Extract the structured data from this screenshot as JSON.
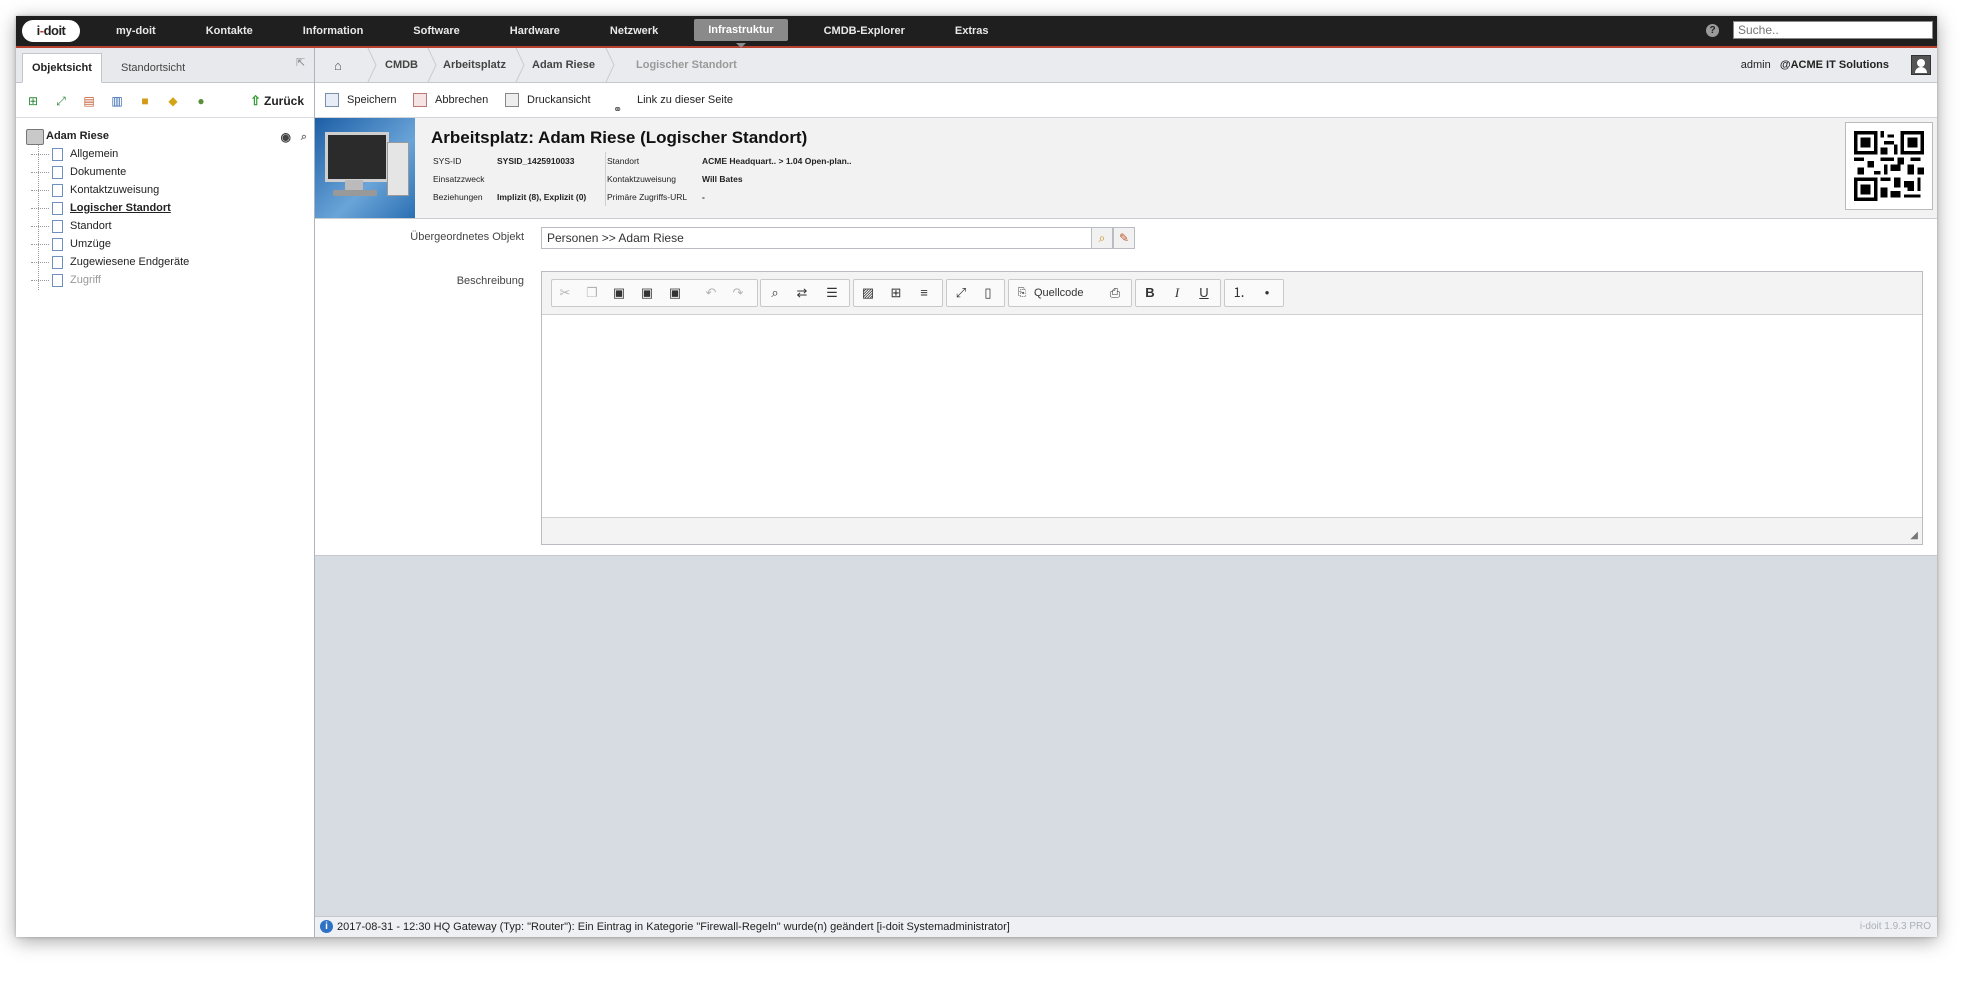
{
  "topnav": {
    "logo": "i-doit",
    "items": [
      "my-doit",
      "Kontakte",
      "Information",
      "Software",
      "Hardware",
      "Netzwerk",
      "Infrastruktur",
      "CMDB-Explorer",
      "Extras"
    ],
    "active_item": "Infrastruktur",
    "search_placeholder": "Suche.."
  },
  "left_panel": {
    "tabs": [
      "Objektsicht",
      "Standortsicht"
    ],
    "back_label": "Zurück",
    "tree": {
      "root": "Adam Riese",
      "items": [
        "Allgemein",
        "Dokumente",
        "Kontaktzuweisung",
        "Logischer Standort",
        "Standort",
        "Umzüge",
        "Zugewiesene Endgeräte",
        "Zugriff"
      ],
      "active": "Logischer Standort",
      "disabled": "Zugriff"
    }
  },
  "breadcrumb": [
    "CMDB",
    "Arbeitsplatz",
    "Adam Riese",
    "Logischer Standort"
  ],
  "user": {
    "name": "admin",
    "tenant": "@ACME IT Solutions"
  },
  "actions": [
    "Speichern",
    "Abbrechen",
    "Druckansicht",
    "Link zu dieser Seite"
  ],
  "object_header": {
    "title": "Arbeitsplatz: Adam Riese (Logischer Standort)",
    "left_labels": [
      "SYS-ID",
      "Einsatzzweck",
      "Beziehungen"
    ],
    "left_values": [
      "SYSID_1425910033",
      "",
      "Implizit (8), Explizit (0)"
    ],
    "right_labels": [
      "Standort",
      "Kontaktzuweisung",
      "Primäre Zugriffs-URL"
    ],
    "right_values": [
      "ACME Headquart.. > 1.04 Open-plan..",
      "Will Bates",
      "-"
    ]
  },
  "form": {
    "parent_label": "Übergeordnetes Objekt",
    "parent_value": "Personen >> Adam Riese",
    "description_label": "Beschreibung",
    "source_button": "Quellcode"
  },
  "status": {
    "message": "2017-08-31 - 12:30 HQ Gateway (Typ: \"Router\"): Ein Eintrag in Kategorie \"Firewall-Regeln\" wurde(n) geändert [i-doit Systemadministrator]",
    "version": "i-doit 1.9.3 PRO"
  }
}
